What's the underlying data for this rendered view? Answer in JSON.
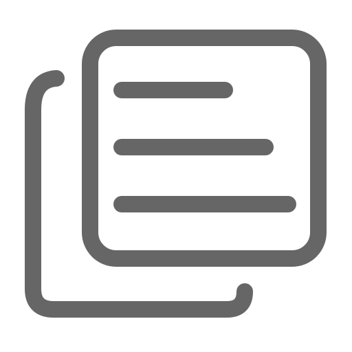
{
  "icon": {
    "name": "copy-document-icon",
    "color": "#666666",
    "background": "#ffffff"
  }
}
